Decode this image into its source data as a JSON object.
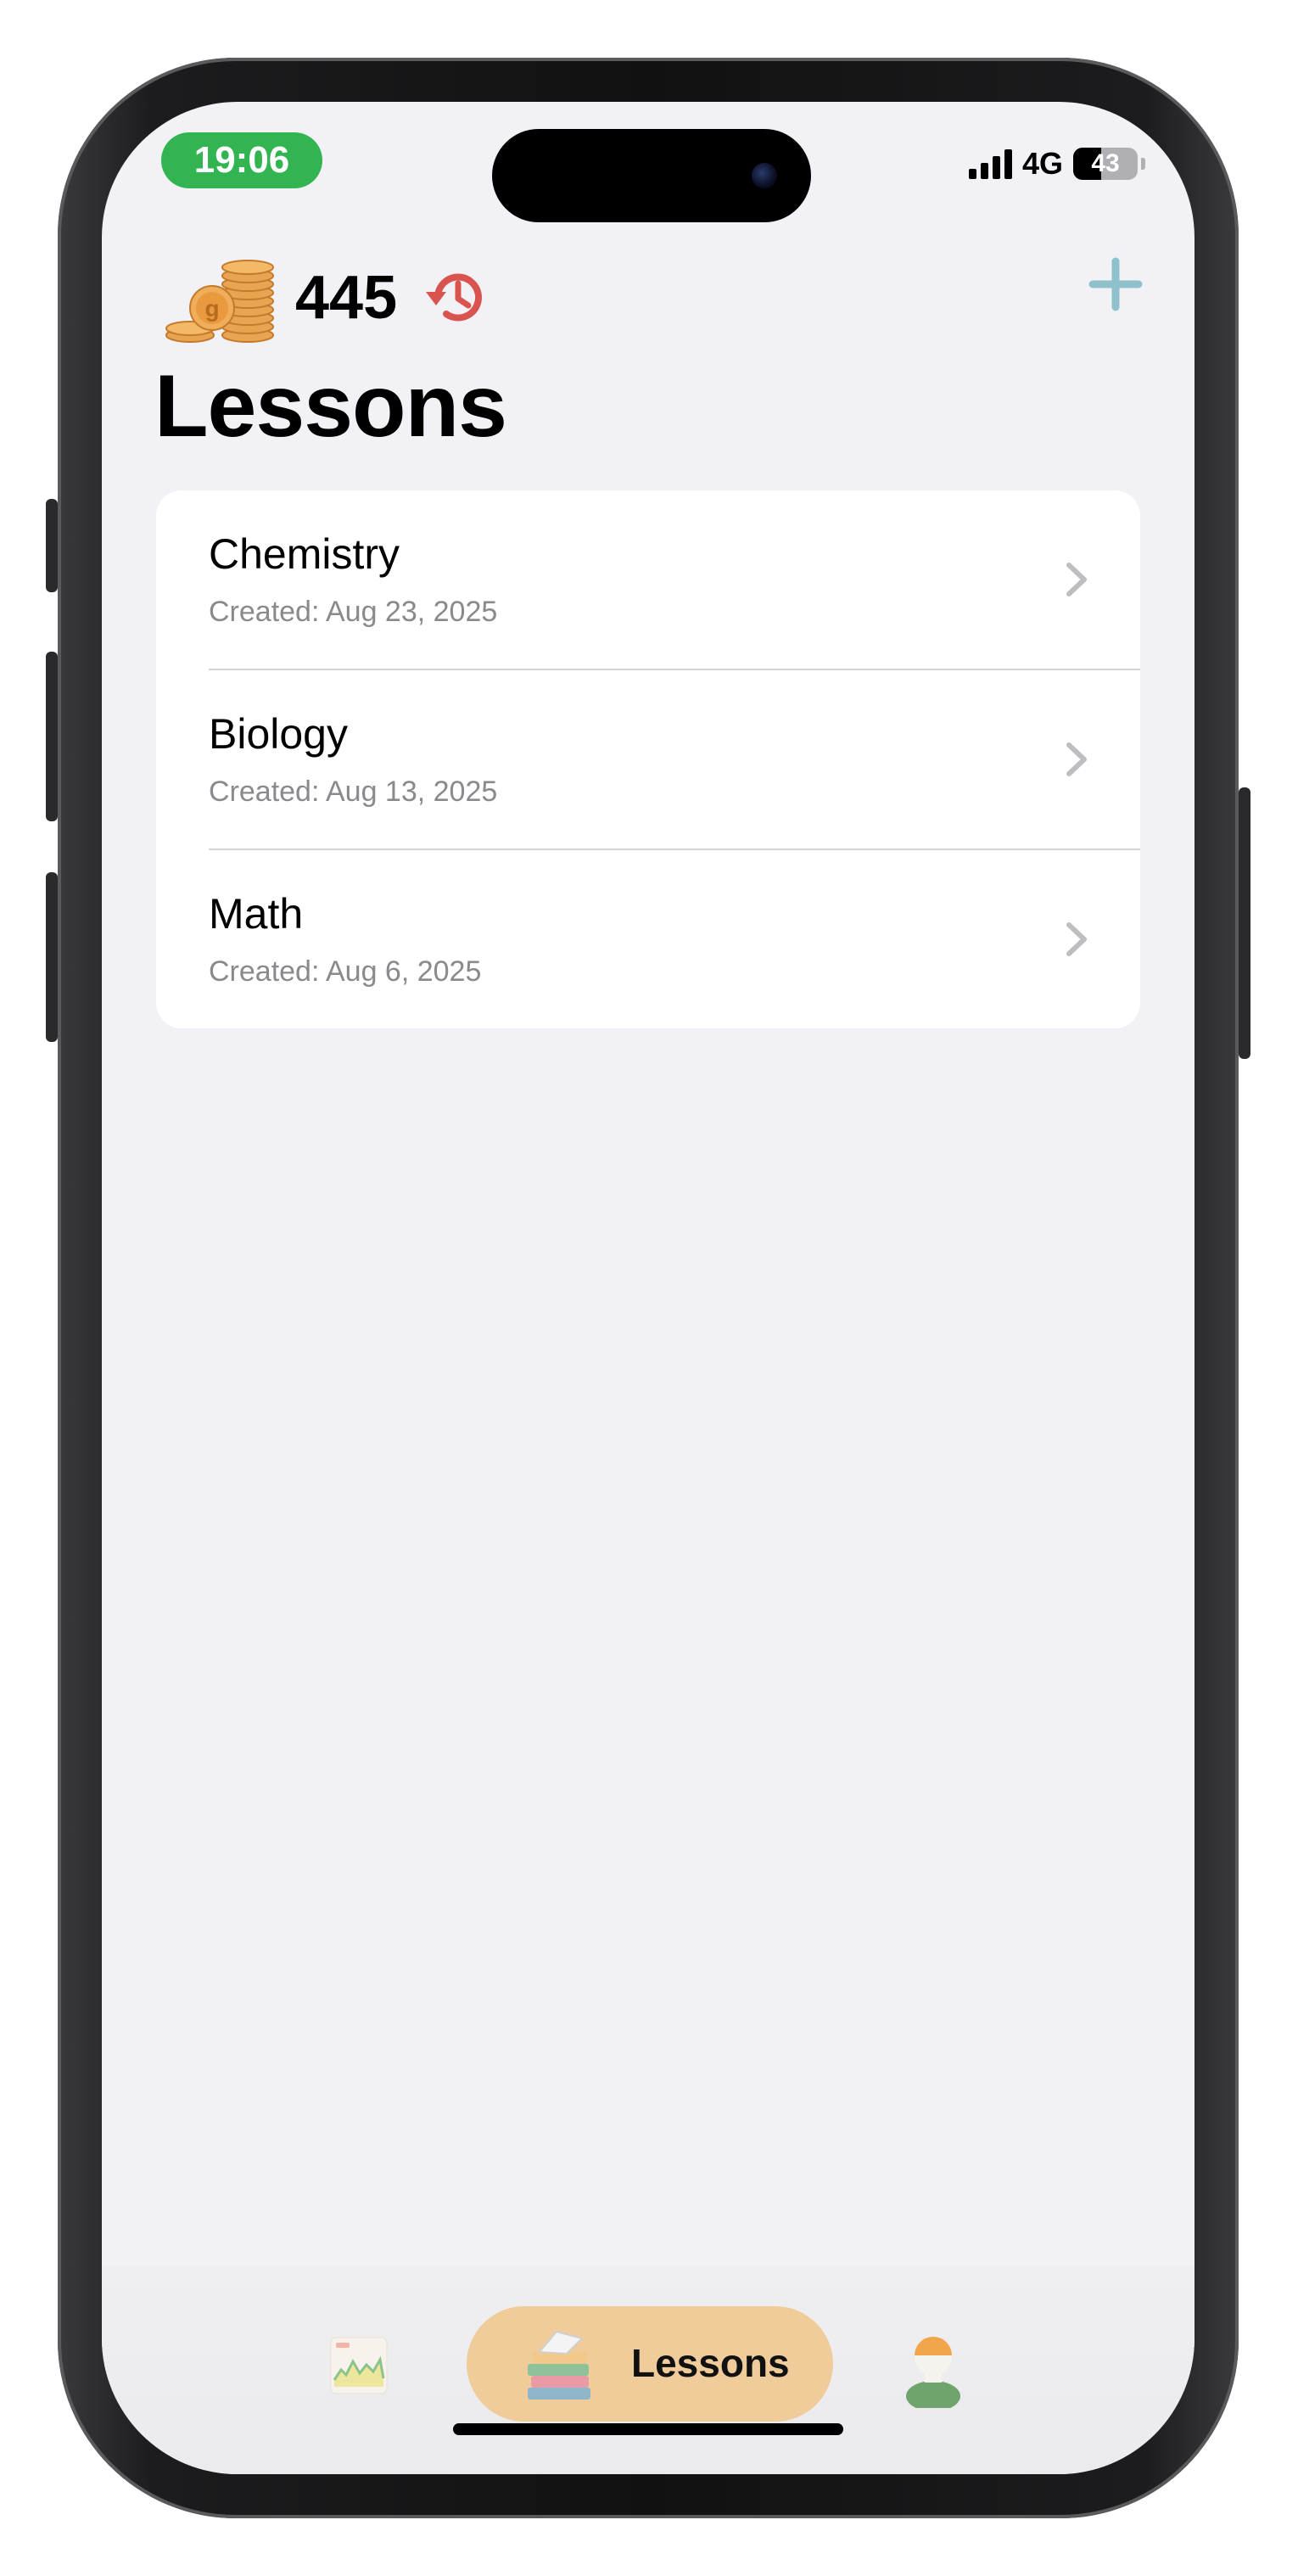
{
  "status_bar": {
    "time": "19:06",
    "network": "4G",
    "battery": "43",
    "battery_level": 0.43
  },
  "header": {
    "coin_count": "445",
    "title": "Lessons"
  },
  "lessons": [
    {
      "name": "Chemistry",
      "created": "Created: Aug 23, 2025"
    },
    {
      "name": "Biology",
      "created": "Created: Aug 13, 2025"
    },
    {
      "name": "Math",
      "created": "Created: Aug 6, 2025"
    }
  ],
  "tab_bar": {
    "active_tab_label": "Lessons",
    "icons": [
      "chart-icon",
      "books-icon",
      "profile-icon"
    ]
  },
  "colors": {
    "accent_add": "#8fc1cc",
    "history_red": "#d9534f",
    "time_pill": "#32b450",
    "active_tab": "#f1cc9b",
    "background": "#f2f1f6"
  }
}
